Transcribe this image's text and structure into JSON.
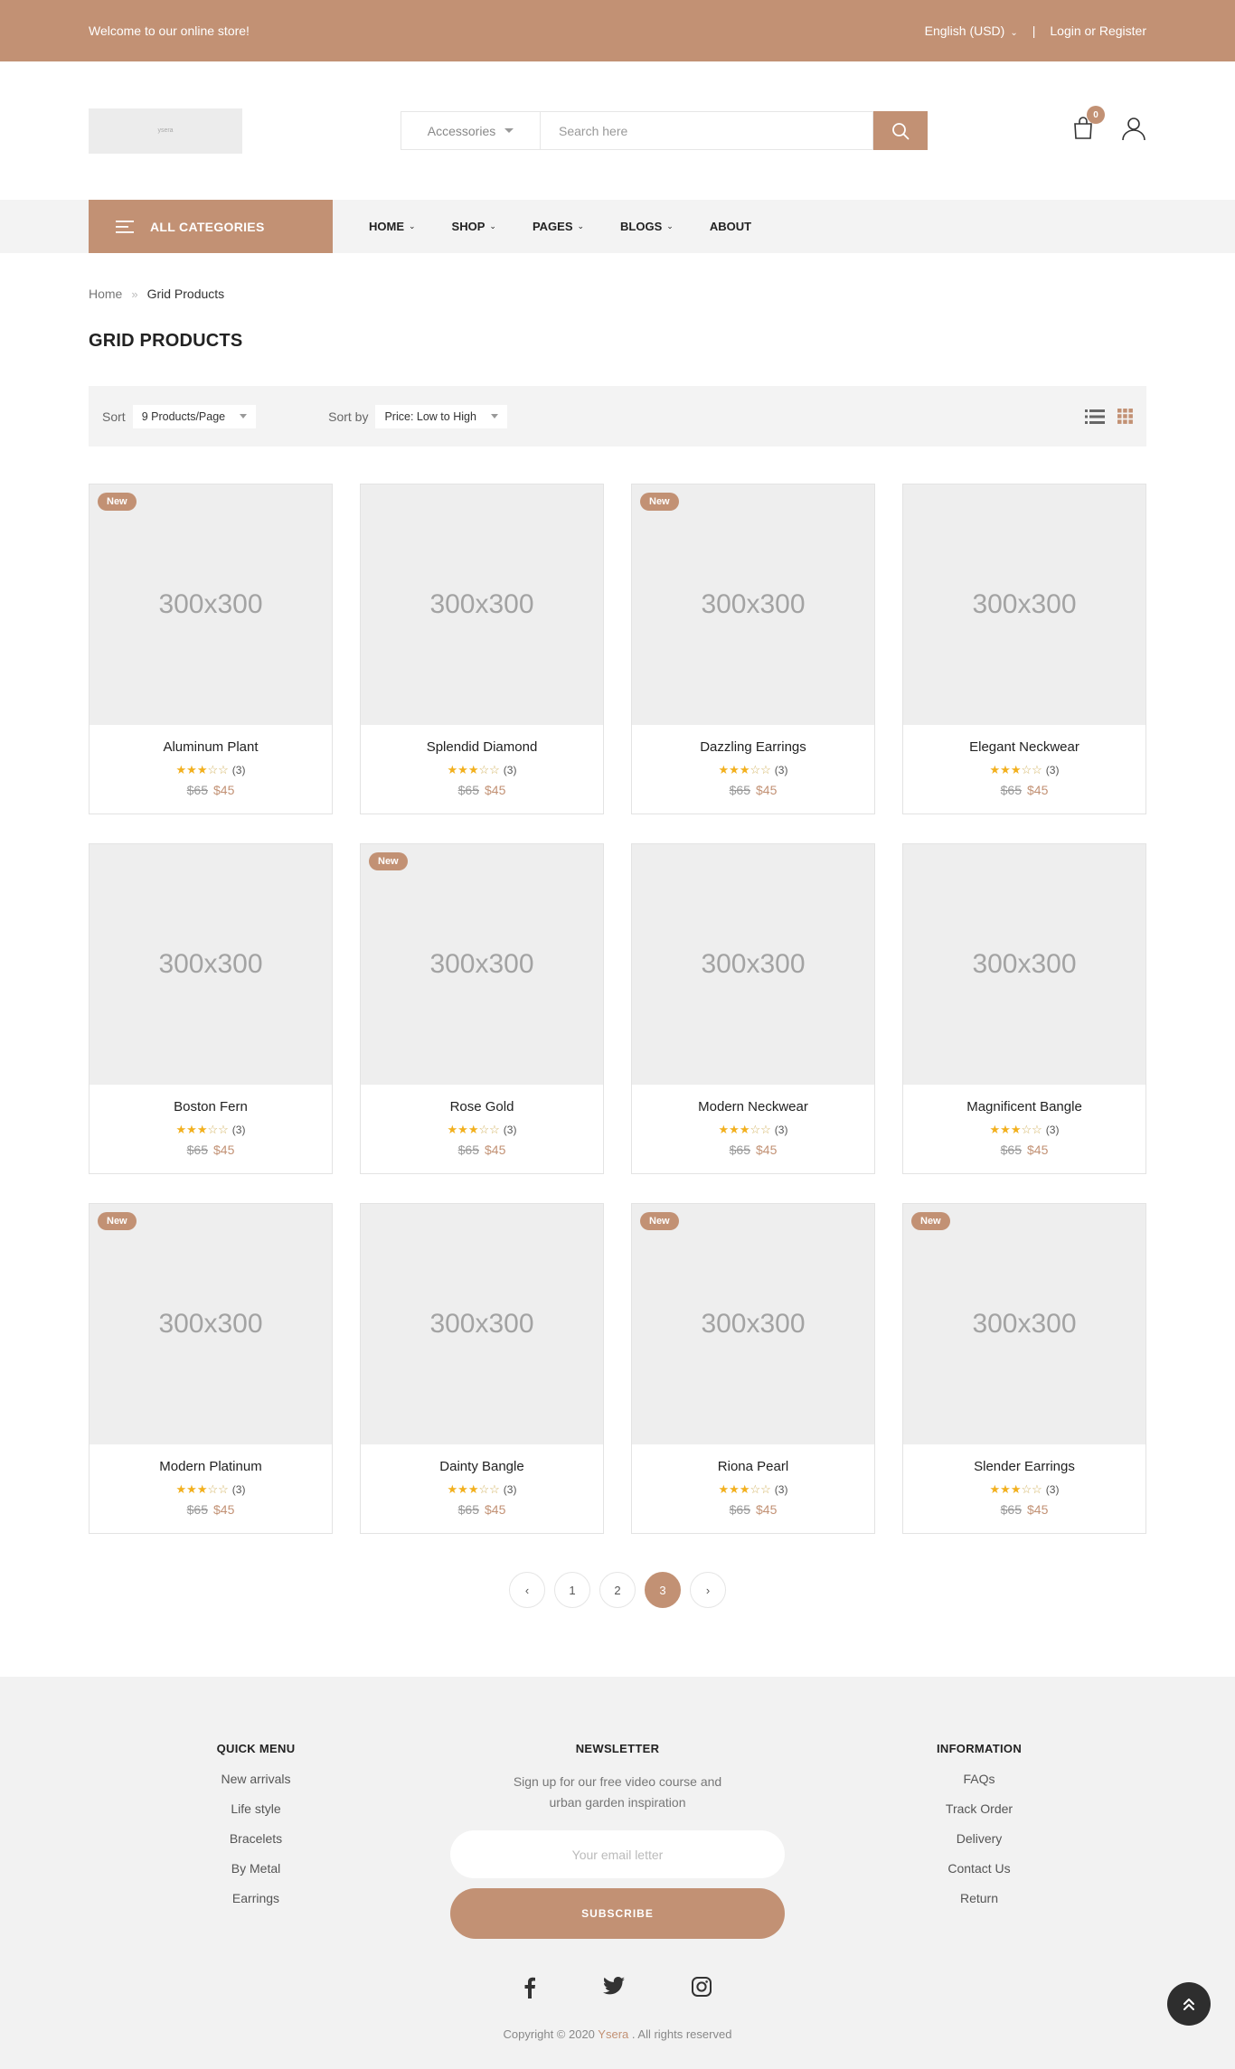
{
  "topbar": {
    "welcome": "Welcome to our online store!",
    "language": "English (USD)",
    "separator": "|",
    "login": "Login or Register"
  },
  "header": {
    "logo_text": "ysera",
    "category_select": "Accessories",
    "search_placeholder": "Search here",
    "cart_count": "0",
    "icons": [
      "search-icon",
      "cart-icon",
      "user-icon"
    ]
  },
  "nav": {
    "all_categories": "ALL CATEGORIES",
    "items": [
      {
        "label": "HOME",
        "has_dropdown": true
      },
      {
        "label": "SHOP",
        "has_dropdown": true
      },
      {
        "label": "PAGES",
        "has_dropdown": true
      },
      {
        "label": "BLOGS",
        "has_dropdown": true
      },
      {
        "label": "ABOUT",
        "has_dropdown": false
      }
    ]
  },
  "breadcrumb": {
    "home": "Home",
    "current": "Grid Products"
  },
  "page_title": "GRID PRODUCTS",
  "toolbar": {
    "sort_label": "Sort",
    "sort_value": "9 Products/Page",
    "sortby_label": "Sort by",
    "sortby_value": "Price: Low to High",
    "views": [
      "list-view-icon",
      "grid-view-icon"
    ]
  },
  "products": [
    {
      "name": "Aluminum Plant",
      "image": "300x300",
      "badge": "New",
      "rating": 3,
      "reviews": "(3)",
      "old_price": "$65",
      "price": "$45"
    },
    {
      "name": "Splendid Diamond",
      "image": "300x300",
      "badge": "",
      "rating": 3,
      "reviews": "(3)",
      "old_price": "$65",
      "price": "$45"
    },
    {
      "name": "Dazzling Earrings",
      "image": "300x300",
      "badge": "New",
      "rating": 3,
      "reviews": "(3)",
      "old_price": "$65",
      "price": "$45"
    },
    {
      "name": "Elegant Neckwear",
      "image": "300x300",
      "badge": "",
      "rating": 3,
      "reviews": "(3)",
      "old_price": "$65",
      "price": "$45"
    },
    {
      "name": "Boston Fern",
      "image": "300x300",
      "badge": "",
      "rating": 3,
      "reviews": "(3)",
      "old_price": "$65",
      "price": "$45"
    },
    {
      "name": "Rose Gold",
      "image": "300x300",
      "badge": "New",
      "rating": 3,
      "reviews": "(3)",
      "old_price": "$65",
      "price": "$45"
    },
    {
      "name": "Modern Neckwear",
      "image": "300x300",
      "badge": "",
      "rating": 3,
      "reviews": "(3)",
      "old_price": "$65",
      "price": "$45"
    },
    {
      "name": "Magnificent Bangle",
      "image": "300x300",
      "badge": "",
      "rating": 3,
      "reviews": "(3)",
      "old_price": "$65",
      "price": "$45"
    },
    {
      "name": "Modern Platinum",
      "image": "300x300",
      "badge": "New",
      "rating": 3,
      "reviews": "(3)",
      "old_price": "$65",
      "price": "$45"
    },
    {
      "name": "Dainty Bangle",
      "image": "300x300",
      "badge": "",
      "rating": 3,
      "reviews": "(3)",
      "old_price": "$65",
      "price": "$45"
    },
    {
      "name": "Riona Pearl",
      "image": "300x300",
      "badge": "New",
      "rating": 3,
      "reviews": "(3)",
      "old_price": "$65",
      "price": "$45"
    },
    {
      "name": "Slender Earrings",
      "image": "300x300",
      "badge": "New",
      "rating": 3,
      "reviews": "(3)",
      "old_price": "$65",
      "price": "$45"
    }
  ],
  "pagination": {
    "pages": [
      "1",
      "2",
      "3"
    ],
    "current": "3"
  },
  "footer": {
    "quick_menu": {
      "title": "QUICK MENU",
      "links": [
        "New arrivals",
        "Life style",
        "Bracelets",
        "By Metal",
        "Earrings"
      ]
    },
    "newsletter": {
      "title": "NEWSLETTER",
      "text": "Sign up for our free video course and urban garden inspiration",
      "email_placeholder": "Your email letter",
      "button": "SUBSCRIBE"
    },
    "information": {
      "title": "INFORMATION",
      "links": [
        "FAQs",
        "Track Order",
        "Delivery",
        "Contact Us",
        "Return"
      ]
    },
    "social": [
      "facebook-icon",
      "twitter-icon",
      "instagram-icon"
    ],
    "copyright_prefix": "Copyright © 2020",
    "copyright_brand": "Ysera",
    "copyright_suffix": ". All rights reserved"
  },
  "colors": {
    "accent": "#c29174",
    "panel": "#f3f3f3",
    "star": "#f2b01e",
    "dark": "#2e2e2e"
  }
}
